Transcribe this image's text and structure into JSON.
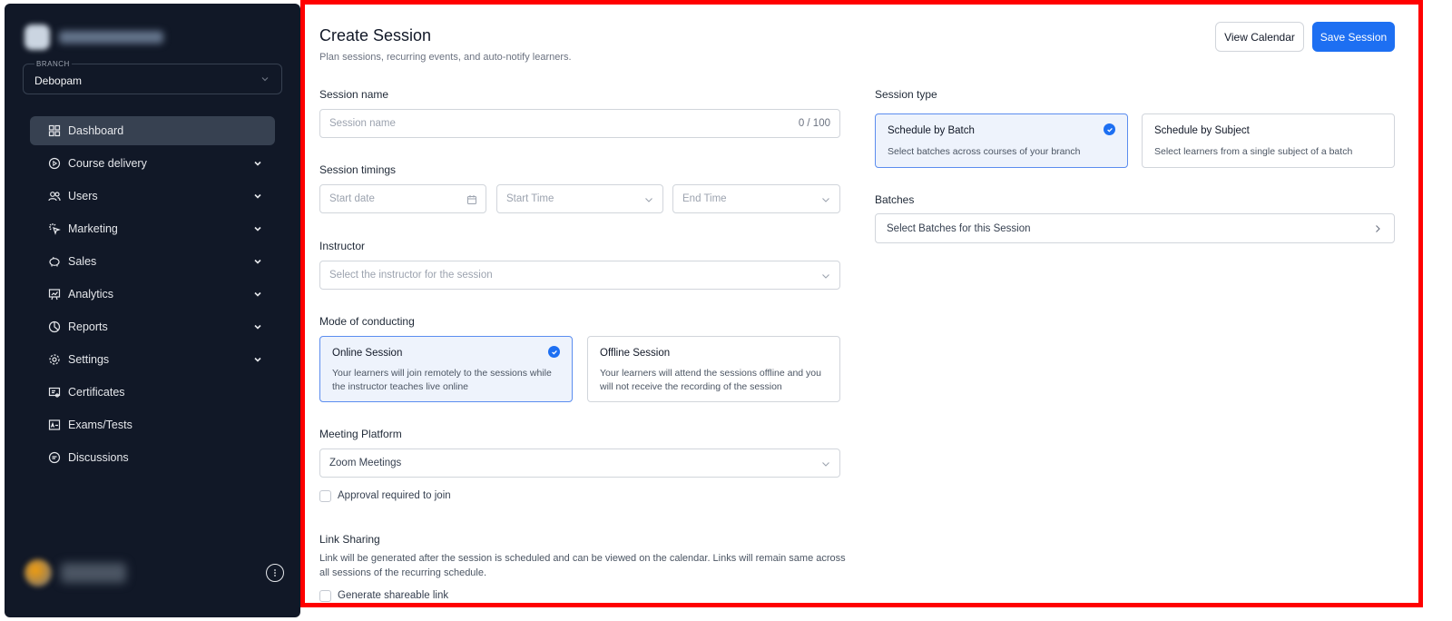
{
  "sidebar": {
    "branch_label": "BRANCH",
    "branch_value": "Debopam",
    "items": [
      {
        "label": "Dashboard",
        "icon": "grid-icon",
        "active": true,
        "expandable": false
      },
      {
        "label": "Course delivery",
        "icon": "play-circle-icon",
        "expandable": true
      },
      {
        "label": "Users",
        "icon": "users-icon",
        "expandable": true
      },
      {
        "label": "Marketing",
        "icon": "cursor-click-icon",
        "expandable": true
      },
      {
        "label": "Sales",
        "icon": "piggy-bank-icon",
        "expandable": true
      },
      {
        "label": "Analytics",
        "icon": "presentation-chart-icon",
        "expandable": true
      },
      {
        "label": "Reports",
        "icon": "pie-chart-icon",
        "expandable": true
      },
      {
        "label": "Settings",
        "icon": "gear-icon",
        "expandable": true
      },
      {
        "label": "Certificates",
        "icon": "certificate-icon",
        "expandable": false
      },
      {
        "label": "Exams/Tests",
        "icon": "exam-icon",
        "expandable": false
      },
      {
        "label": "Discussions",
        "icon": "chat-icon",
        "expandable": false
      }
    ]
  },
  "header": {
    "title": "Create Session",
    "subtitle": "Plan sessions, recurring events, and auto-notify learners.",
    "view_calendar": "View Calendar",
    "save_session": "Save Session"
  },
  "form": {
    "session_name_label": "Session name",
    "session_name_placeholder": "Session name",
    "session_name_counter": "0 / 100",
    "timings_label": "Session timings",
    "start_date_placeholder": "Start date",
    "start_time_placeholder": "Start Time",
    "end_time_placeholder": "End Time",
    "instructor_label": "Instructor",
    "instructor_placeholder": "Select the instructor for the session",
    "mode_label": "Mode of conducting",
    "online_title": "Online Session",
    "online_desc": "Your learners will join remotely to the sessions while the instructor teaches live online",
    "offline_title": "Offline Session",
    "offline_desc": "Your learners will attend the sessions offline and you will not receive the recording of the session",
    "platform_label": "Meeting Platform",
    "platform_value": "Zoom Meetings",
    "approval_label": "Approval required to join",
    "link_sharing_label": "Link Sharing",
    "link_sharing_desc": "Link will be generated after the session is scheduled and can be viewed on the calendar. Links will remain same across all sessions of the recurring schedule.",
    "generate_link_label": "Generate shareable link"
  },
  "right": {
    "session_type_label": "Session type",
    "batch_title": "Schedule by Batch",
    "batch_desc": "Select batches across courses of your branch",
    "subject_title": "Schedule by Subject",
    "subject_desc": "Select learners from a single subject of a batch",
    "batches_label": "Batches",
    "batches_select": "Select Batches for this Session"
  },
  "colors": {
    "primary": "#1d6ff2",
    "sidebar_bg": "#111827",
    "selected_card_bg": "#eef3fc",
    "frame": "#ff0000"
  }
}
